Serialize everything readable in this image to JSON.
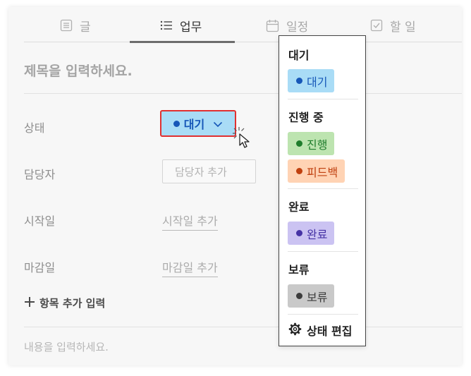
{
  "tabs": [
    {
      "label": "글",
      "icon": "document-icon"
    },
    {
      "label": "업무",
      "icon": "list-icon"
    },
    {
      "label": "일정",
      "icon": "calendar-icon"
    },
    {
      "label": "할 일",
      "icon": "checkbox-icon"
    }
  ],
  "active_tab": "업무",
  "title_placeholder": "제목을 입력하세요.",
  "fields": {
    "status": {
      "label": "상태",
      "value": "대기",
      "color": "#1657b8",
      "bg": "#a9dcf6"
    },
    "assignee": {
      "label": "담당자",
      "placeholder": "담당자 추가"
    },
    "start_date": {
      "label": "시작일",
      "placeholder": "시작일 추가"
    },
    "due_date": {
      "label": "마감일",
      "placeholder": "마감일 추가"
    }
  },
  "add_field_label": "항목 추가 입력",
  "content_placeholder": "내용을 입력하세요.",
  "dropdown": {
    "groups": [
      {
        "title": "대기",
        "chips": [
          {
            "label": "대기",
            "color": "#1657b8",
            "bg": "#a9dcf6"
          }
        ]
      },
      {
        "title": "진행 중",
        "chips": [
          {
            "label": "진행",
            "color": "#1f7d2c",
            "bg": "#bde4b0"
          },
          {
            "label": "피드백",
            "color": "#c0400f",
            "bg": "#ffd3b4"
          }
        ]
      },
      {
        "title": "완료",
        "chips": [
          {
            "label": "완료",
            "color": "#4633a5",
            "bg": "#cbc3f2"
          }
        ]
      },
      {
        "title": "보류",
        "chips": [
          {
            "label": "보류",
            "color": "#3c3c3c",
            "bg": "#c9c9c9"
          }
        ]
      }
    ],
    "edit_label": "상태 편집",
    "edit_icon": "gear-icon"
  }
}
